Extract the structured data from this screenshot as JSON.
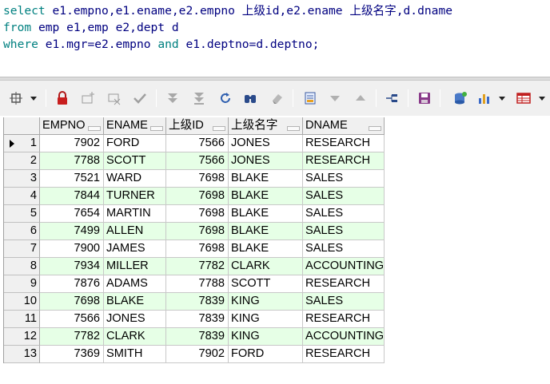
{
  "editor": {
    "lines": [
      {
        "segments": [
          {
            "text": "select e1.empno,e1.ename,e2.empno 上级id,e2.ename 上级名字,d.dname",
            "cls": "kw-mixed"
          }
        ]
      },
      {
        "segments": [
          {
            "text": "from emp e1,emp e2,dept d",
            "cls": "kw-mixed"
          }
        ]
      },
      {
        "segments": [
          {
            "text": "where e1.mgr=e2.empno and e1.deptno=d.deptno;",
            "cls": "kw-mixed"
          }
        ]
      }
    ],
    "line1_kw": "select",
    "line1_rest": " e1.empno,e1.ename,e2.empno 上级id,e2.ename 上级名字,d.dname",
    "line2_kw": "from",
    "line2_rest": " emp e1,emp e2,dept d",
    "line3_kw": "where",
    "line3_mid": " e1.mgr=e2.empno ",
    "line3_kw2": "and",
    "line3_rest": " e1.deptno=d.deptno;"
  },
  "toolbar": {
    "icons": [
      "grid-settings-icon",
      "lock-icon",
      "add-record-icon",
      "delete-record-icon",
      "post-icon",
      "fetch-next-icon",
      "fetch-last-icon",
      "refresh-icon",
      "find-icon",
      "clear-icon",
      "save-query-icon",
      "sort-desc-icon",
      "sort-asc-icon",
      "connect-icon",
      "save-icon",
      "export-icon",
      "chart-icon",
      "table-icon"
    ]
  },
  "grid": {
    "columns": [
      "EMPNO",
      "ENAME",
      "上级ID",
      "上级名字",
      "DNAME"
    ],
    "rows": [
      {
        "n": "1",
        "empno": "7902",
        "ename": "FORD",
        "mgrid": "7566",
        "mgrname": "JONES",
        "dname": "RESEARCH"
      },
      {
        "n": "2",
        "empno": "7788",
        "ename": "SCOTT",
        "mgrid": "7566",
        "mgrname": "JONES",
        "dname": "RESEARCH"
      },
      {
        "n": "3",
        "empno": "7521",
        "ename": "WARD",
        "mgrid": "7698",
        "mgrname": "BLAKE",
        "dname": "SALES"
      },
      {
        "n": "4",
        "empno": "7844",
        "ename": "TURNER",
        "mgrid": "7698",
        "mgrname": "BLAKE",
        "dname": "SALES"
      },
      {
        "n": "5",
        "empno": "7654",
        "ename": "MARTIN",
        "mgrid": "7698",
        "mgrname": "BLAKE",
        "dname": "SALES"
      },
      {
        "n": "6",
        "empno": "7499",
        "ename": "ALLEN",
        "mgrid": "7698",
        "mgrname": "BLAKE",
        "dname": "SALES"
      },
      {
        "n": "7",
        "empno": "7900",
        "ename": "JAMES",
        "mgrid": "7698",
        "mgrname": "BLAKE",
        "dname": "SALES"
      },
      {
        "n": "8",
        "empno": "7934",
        "ename": "MILLER",
        "mgrid": "7782",
        "mgrname": "CLARK",
        "dname": "ACCOUNTING"
      },
      {
        "n": "9",
        "empno": "7876",
        "ename": "ADAMS",
        "mgrid": "7788",
        "mgrname": "SCOTT",
        "dname": "RESEARCH"
      },
      {
        "n": "10",
        "empno": "7698",
        "ename": "BLAKE",
        "mgrid": "7839",
        "mgrname": "KING",
        "dname": "SALES"
      },
      {
        "n": "11",
        "empno": "7566",
        "ename": "JONES",
        "mgrid": "7839",
        "mgrname": "KING",
        "dname": "RESEARCH"
      },
      {
        "n": "12",
        "empno": "7782",
        "ename": "CLARK",
        "mgrid": "7839",
        "mgrname": "KING",
        "dname": "ACCOUNTING"
      },
      {
        "n": "13",
        "empno": "7369",
        "ename": "SMITH",
        "mgrid": "7902",
        "mgrname": "FORD",
        "dname": "RESEARCH"
      }
    ]
  },
  "colors": {
    "alt_row": "#e6ffe6",
    "keyword": "#008080",
    "code": "#000080"
  }
}
